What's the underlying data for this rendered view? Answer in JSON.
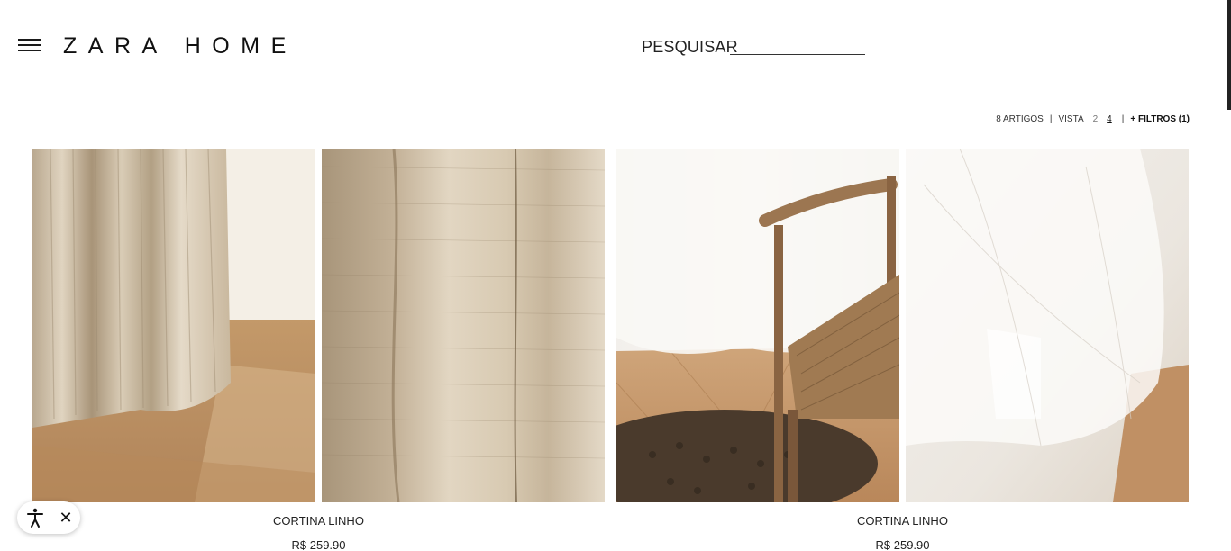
{
  "header": {
    "logo": "ZARA HOME",
    "menu_icon": "hamburger-icon",
    "search_label": "PESQUISAR"
  },
  "toolbar": {
    "count": "8 ARTIGOS",
    "sep1": "|",
    "view_label": "VISTA",
    "view_options": [
      "2",
      "4"
    ],
    "active_view": "4",
    "sep2": "|",
    "filters": "+ FILTROS (1)"
  },
  "products": [
    {
      "name": "CORTINA LINHO",
      "price": "R$ 259.90",
      "images": [
        "beige-linen-curtain-room",
        "beige-linen-curtain-closeup"
      ]
    },
    {
      "name": "CORTINA LINHO",
      "price": "R$ 259.90",
      "images": [
        "white-linen-curtain-chair",
        "white-linen-curtain-closeup"
      ]
    }
  ],
  "accessibility": {
    "icon": "accessibility-icon",
    "close_symbol": "✕"
  },
  "colors": {
    "text": "#1a1a1a",
    "background": "#ffffff"
  }
}
